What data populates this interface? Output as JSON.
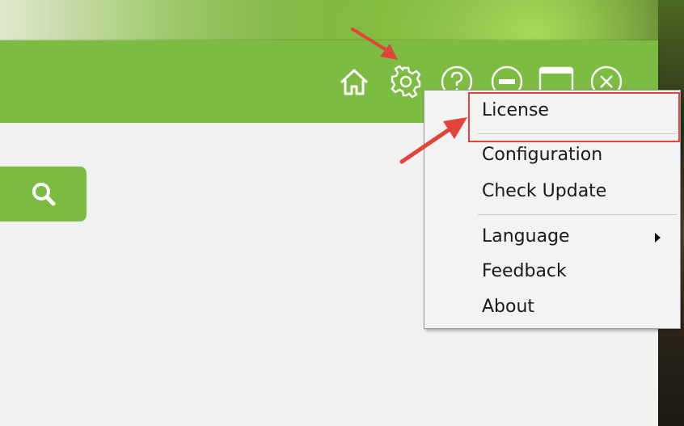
{
  "titlebar": {
    "icons": [
      "home-icon",
      "gear-icon",
      "help-icon",
      "minimize-icon",
      "maximize-icon",
      "close-icon"
    ]
  },
  "search": {
    "icon": "search-icon"
  },
  "menu": {
    "license": "License",
    "configuration": "Configuration",
    "check_update": "Check Update",
    "language": "Language",
    "feedback": "Feedback",
    "about": "About"
  },
  "colors": {
    "accent": "#7cbc42",
    "annotation": "#e0443a",
    "menu_bg": "#f3f3f3"
  }
}
